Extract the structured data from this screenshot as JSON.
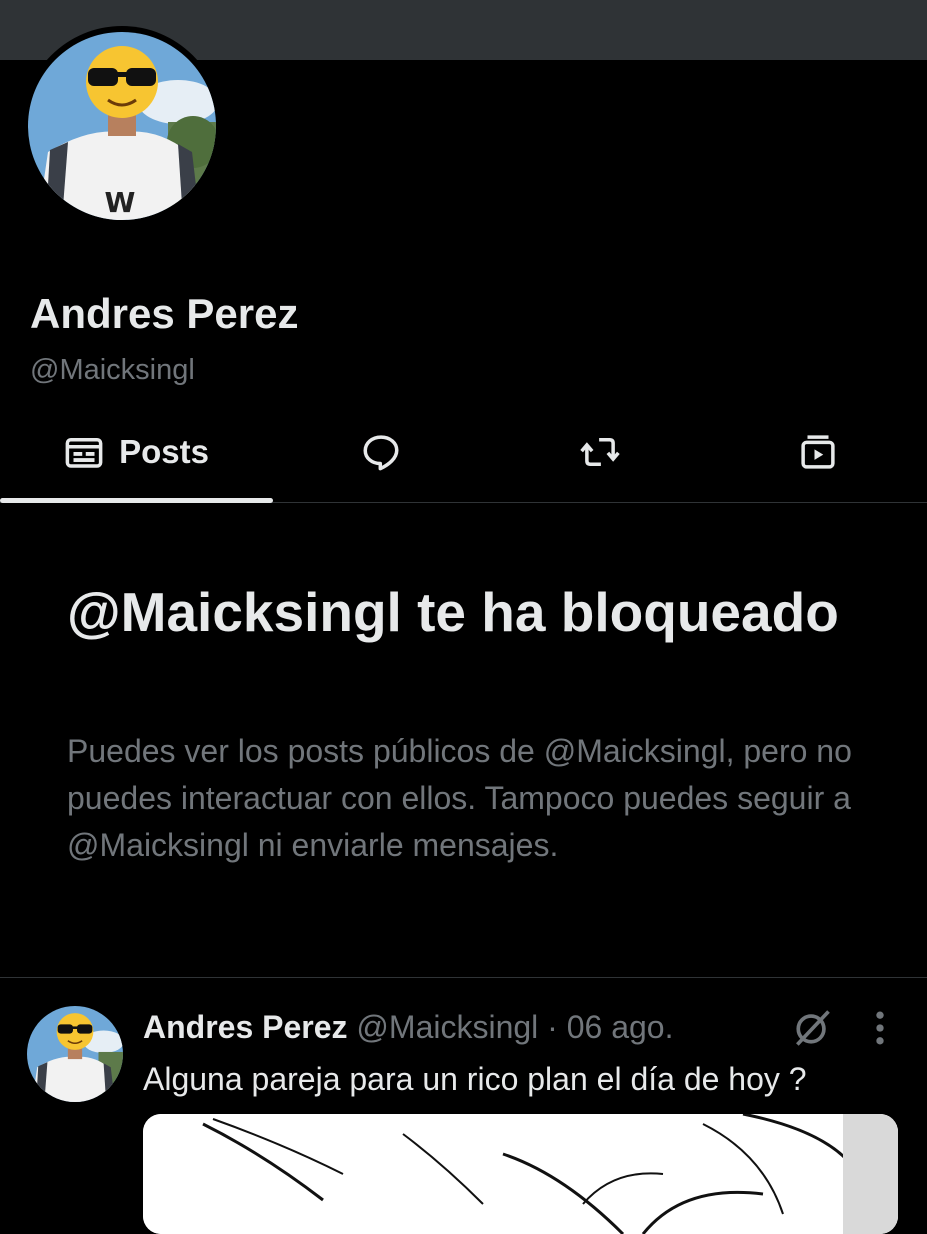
{
  "profile": {
    "name": "Andres Perez",
    "handle": "@Maicksingl"
  },
  "tabs": [
    {
      "label": "Posts",
      "icon": "posts-icon",
      "selected": true
    },
    {
      "label": "",
      "icon": "replies-icon"
    },
    {
      "label": "",
      "icon": "reposts-icon"
    },
    {
      "label": "",
      "icon": "media-icon"
    }
  ],
  "blocked_notice": {
    "title": "@Maicksingl te ha bloqueado",
    "message": "Puedes ver los posts públicos de @Maicksingl, pero no puedes interactuar con ellos. Tampoco puedes seguir a @Maicksingl ni enviarle mensajes."
  },
  "post": {
    "author": "Andres Perez",
    "handle": "@Maicksingl",
    "separator": "·",
    "date": "06 ago.",
    "text": "Alguna pareja para un rico plan el día de hoy ?"
  },
  "colors": {
    "background": "#000000",
    "text_primary": "#e7e9ea",
    "text_secondary": "#71767b",
    "divider": "#2f3336"
  }
}
